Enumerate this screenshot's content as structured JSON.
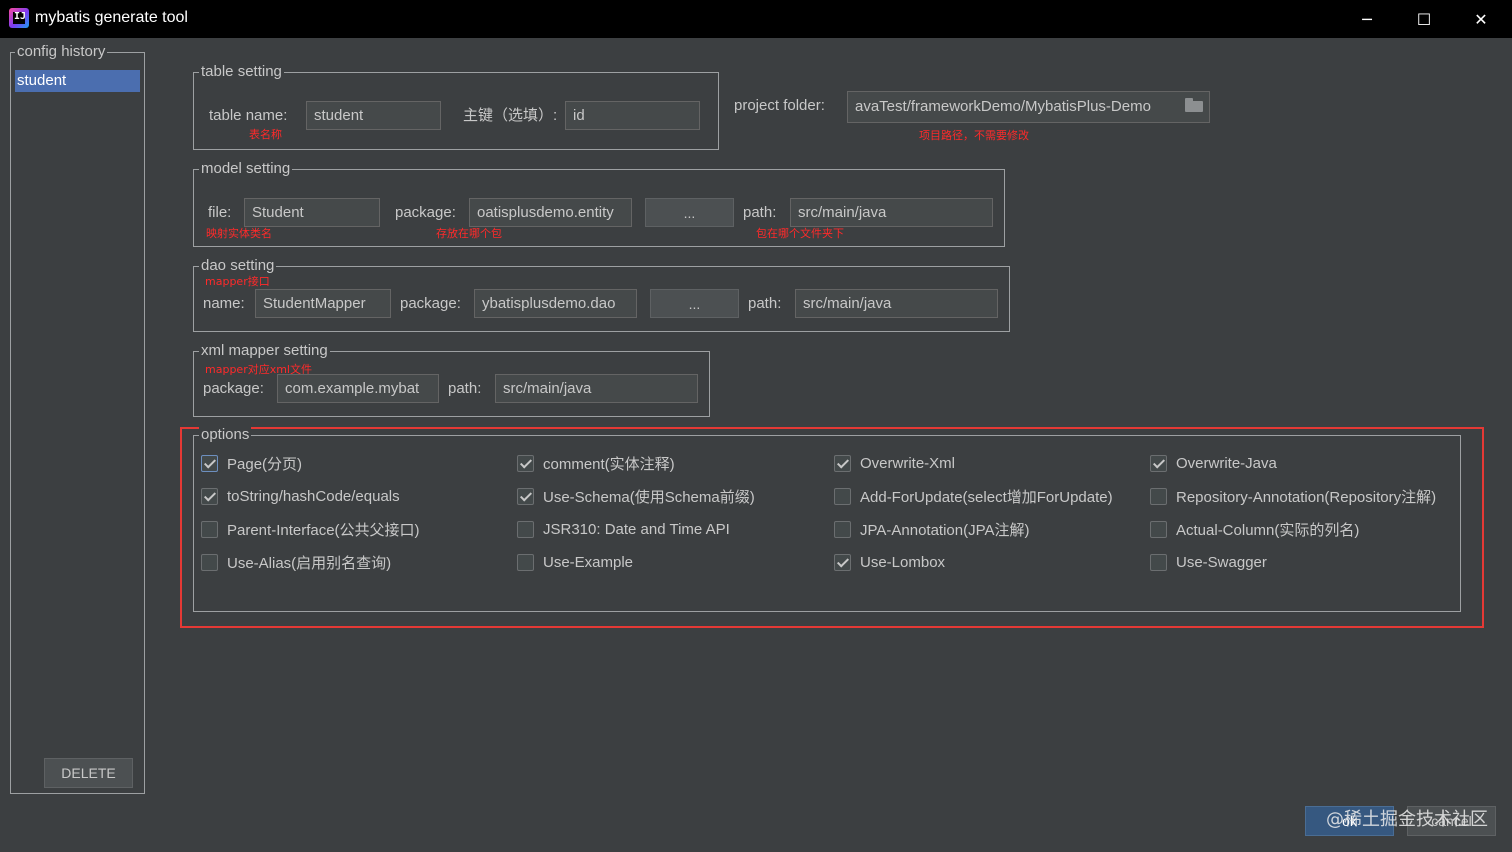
{
  "window": {
    "title": "mybatis generate tool",
    "app_icon": "intellij-icon",
    "minimize": "─",
    "maximize": "☐",
    "close": "✕"
  },
  "history": {
    "legend": "config history",
    "items": [
      "student"
    ],
    "delete_label": "DELETE"
  },
  "table_setting": {
    "legend": "table setting",
    "name_label": "table  name:",
    "name_value": "student",
    "name_note": "表名称",
    "pk_label": "主键（选填）:",
    "pk_value": "id"
  },
  "project": {
    "label": "project folder:",
    "value": "avaTest/frameworkDemo/MybatisPlus-Demo",
    "note": "项目路径，不需要修改"
  },
  "model_setting": {
    "legend": "model setting",
    "file_label": "file:",
    "file_value": "Student",
    "file_note": "映射实体类名",
    "package_label": "package:",
    "package_value": "oatisplusdemo.entity",
    "package_note": "存放在哪个包",
    "browse_label": "...",
    "path_label": "path:",
    "path_value": "src/main/java",
    "path_note": "包在哪个文件夹下"
  },
  "dao_setting": {
    "legend": "dao setting",
    "note": "mapper接口",
    "name_label": "name:",
    "name_value": "StudentMapper",
    "package_label": "package:",
    "package_value": "ybatisplusdemo.dao",
    "browse_label": "...",
    "path_label": "path:",
    "path_value": "src/main/java"
  },
  "xml_setting": {
    "legend": "xml mapper setting",
    "note": "mapper对应xml文件",
    "package_label": "package:",
    "package_value": "com.example.mybat",
    "path_label": "path:",
    "path_value": "src/main/java"
  },
  "options": {
    "legend": "options",
    "items": [
      {
        "label": "Page(分页)",
        "checked": true
      },
      {
        "label": "comment(实体注释)",
        "checked": true
      },
      {
        "label": "Overwrite-Xml",
        "checked": true
      },
      {
        "label": "Overwrite-Java",
        "checked": true
      },
      {
        "label": "toString/hashCode/equals",
        "checked": true
      },
      {
        "label": "Use-Schema(使用Schema前缀)",
        "checked": true
      },
      {
        "label": "Add-ForUpdate(select增加ForUpdate)",
        "checked": false
      },
      {
        "label": "Repository-Annotation(Repository注解)",
        "checked": false
      },
      {
        "label": "Parent-Interface(公共父接口)",
        "checked": false
      },
      {
        "label": "JSR310: Date and Time API",
        "checked": false
      },
      {
        "label": "JPA-Annotation(JPA注解)",
        "checked": false
      },
      {
        "label": "Actual-Column(实际的列名)",
        "checked": false
      },
      {
        "label": "Use-Alias(启用别名查询)",
        "checked": false
      },
      {
        "label": "Use-Example",
        "checked": false
      },
      {
        "label": "Use-Lombox",
        "checked": true
      },
      {
        "label": "Use-Swagger",
        "checked": false
      }
    ]
  },
  "footer": {
    "ok_label": "ok",
    "cancel_label": "cancel",
    "watermark": "@稀土掘金技术社区"
  },
  "colors": {
    "background": "#3c3f41",
    "selection": "#4b6eaf",
    "note_red": "#ff2a2a",
    "highlight_red": "#e53935",
    "ok_blue": "#365880"
  }
}
